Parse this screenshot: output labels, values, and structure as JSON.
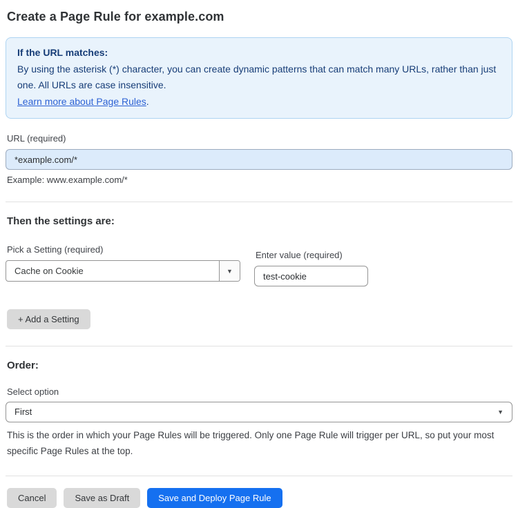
{
  "page": {
    "title": "Create a Page Rule for example.com"
  },
  "info_box": {
    "heading": "If the URL matches:",
    "body": "By using the asterisk (*) character, you can create dynamic patterns that can match many URLs, rather than just one. All URLs are case insensitive.",
    "link": "Learn more about Page Rules",
    "link_suffix": "."
  },
  "url_section": {
    "label": "URL (required)",
    "value": "*example.com/*",
    "helper": "Example: www.example.com/*"
  },
  "settings_section": {
    "heading": "Then the settings are:",
    "setting_label": "Pick a Setting (required)",
    "setting_value": "Cache on Cookie",
    "setting_arrow": "▼",
    "value_label": "Enter value (required)",
    "value_value": "test-cookie",
    "add_button_label": "+ Add a Setting"
  },
  "order_section": {
    "heading": "Order:",
    "label": "Select option",
    "value": "First",
    "arrow": "▼",
    "helper": "This is the order in which your Page Rules will be triggered. Only one Page Rule will trigger per URL, so put your most specific Page Rules at the top."
  },
  "footer": {
    "cancel_label": "Cancel",
    "save_draft_label": "Save as Draft",
    "save_deploy_label": "Save and Deploy Page Rule"
  },
  "colors": {
    "accent_blue": "#1570f0",
    "info_bg": "#e9f3fc",
    "info_border": "#aed4f2",
    "info_text": "#173d77",
    "link_blue": "#2d62d4",
    "url_input_bg": "#dcebfb",
    "gray_button": "#d9d9d9"
  }
}
